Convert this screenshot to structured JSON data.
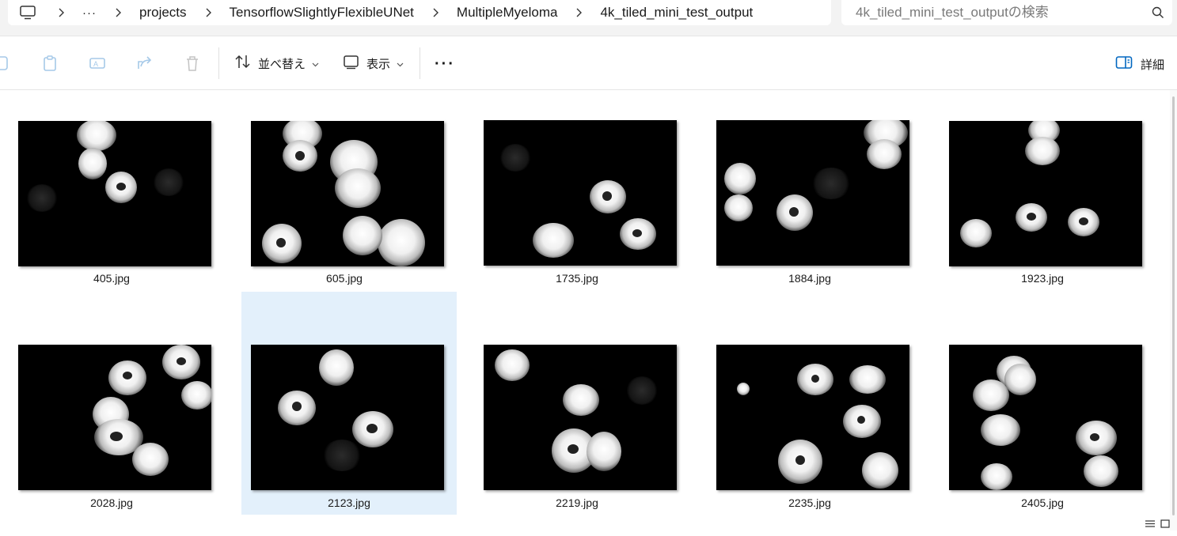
{
  "address": {
    "pc_icon": "computer-icon",
    "overflow": "···",
    "crumbs": [
      "projects",
      "TensorflowSlightlyFlexibleUNet",
      "MultipleMyeloma",
      "4k_tiled_mini_test_output"
    ]
  },
  "search": {
    "placeholder": "4k_tiled_mini_test_outputの検索"
  },
  "toolbar": {
    "sort_label": "並べ替え",
    "view_label": "表示",
    "more_label": "···",
    "details_label": "詳細"
  },
  "files": [
    {
      "name": "405.jpg"
    },
    {
      "name": "605.jpg"
    },
    {
      "name": "1735.jpg"
    },
    {
      "name": "1884.jpg"
    },
    {
      "name": "1923.jpg"
    },
    {
      "name": "2028.jpg"
    },
    {
      "name": "2123.jpg"
    },
    {
      "name": "2219.jpg"
    },
    {
      "name": "2235.jpg"
    },
    {
      "name": "2405.jpg"
    }
  ],
  "selected_file": "2123.jpg",
  "colors": {
    "selection": "#e3f0fb",
    "toolbar_bg": "#ffffff",
    "addr_bg": "#f3f3f3"
  }
}
